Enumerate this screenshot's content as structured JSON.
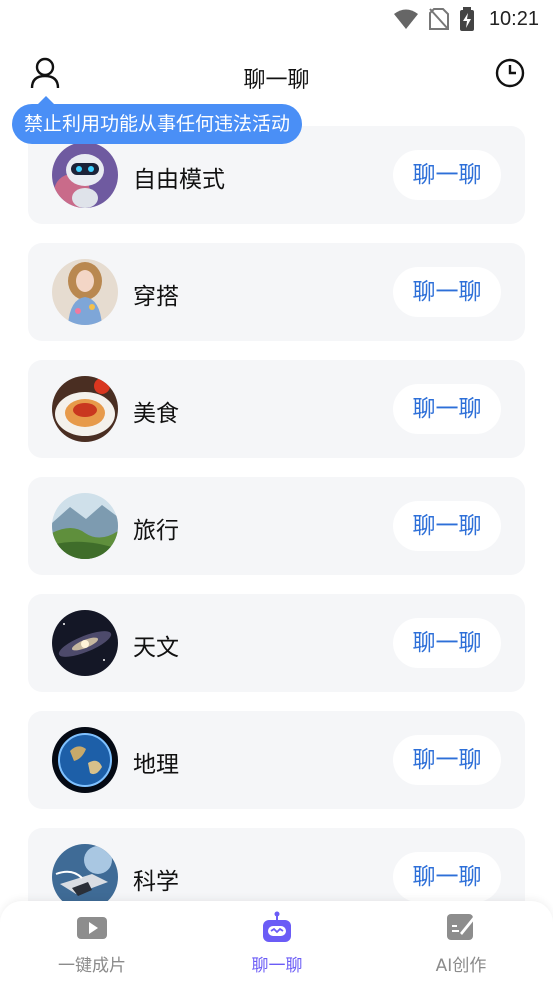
{
  "status_bar": {
    "time": "10:21",
    "icons": [
      "wifi-icon",
      "no-sim-icon",
      "battery-charging-icon"
    ]
  },
  "header": {
    "title": "聊一聊",
    "left_icon": "user-icon",
    "right_icon": "history-clock-icon"
  },
  "warning_tooltip": "禁止利用功能从事任何违法活动",
  "topics": [
    {
      "label": "自由模式",
      "button": "聊一聊",
      "avatar": "robot"
    },
    {
      "label": "穿搭",
      "button": "聊一聊",
      "avatar": "doll"
    },
    {
      "label": "美食",
      "button": "聊一聊",
      "avatar": "pasta"
    },
    {
      "label": "旅行",
      "button": "聊一聊",
      "avatar": "valley"
    },
    {
      "label": "天文",
      "button": "聊一聊",
      "avatar": "galaxy"
    },
    {
      "label": "地理",
      "button": "聊一聊",
      "avatar": "earth"
    },
    {
      "label": "科学",
      "button": "聊一聊",
      "avatar": "spacecraft"
    }
  ],
  "bottom_nav": {
    "items": [
      {
        "label": "一键成片",
        "icon": "video-icon",
        "active": false
      },
      {
        "label": "聊一聊",
        "icon": "robot-chat-icon",
        "active": true
      },
      {
        "label": "AI创作",
        "icon": "ai-write-icon",
        "active": false
      }
    ]
  },
  "colors": {
    "accent_blue": "#2d6fd8",
    "tooltip_blue": "#4a8ff6",
    "nav_active": "#6b5cf6",
    "card_bg": "#f5f6f8"
  }
}
